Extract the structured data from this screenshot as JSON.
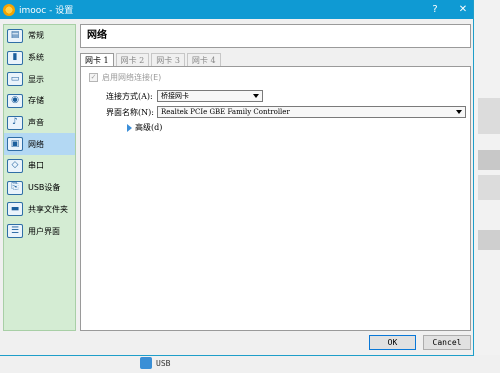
{
  "window": {
    "title": "imooc - 设置",
    "help_btn": "?",
    "close_btn": "✕"
  },
  "sidebar": {
    "items": [
      {
        "label": "常规",
        "icon": "general-icon"
      },
      {
        "label": "系统",
        "icon": "system-icon"
      },
      {
        "label": "显示",
        "icon": "display-icon"
      },
      {
        "label": "存储",
        "icon": "storage-icon"
      },
      {
        "label": "声音",
        "icon": "audio-icon"
      },
      {
        "label": "网络",
        "icon": "network-icon"
      },
      {
        "label": "串口",
        "icon": "serial-port-icon"
      },
      {
        "label": "USB设备",
        "icon": "usb-icon"
      },
      {
        "label": "共享文件夹",
        "icon": "shared-folder-icon"
      },
      {
        "label": "用户界面",
        "icon": "user-interface-icon"
      }
    ],
    "active": "网络"
  },
  "main": {
    "header": "网络",
    "tabs": [
      "网卡 1",
      "网卡 2",
      "网卡 3",
      "网卡 4"
    ],
    "enable_label": "启用网络连接(E)",
    "attach_label": "连接方式(A):",
    "attach_value": "桥接网卡",
    "name_label": "界面名称(N):",
    "name_value": "Realtek PCIe GBE Family Controller",
    "advanced_label": "高级(d)"
  },
  "footer": {
    "ok": "OK",
    "cancel": "Cancel"
  },
  "background": {
    "usb_label": "USB"
  },
  "colors": {
    "titlebar": "#0f9ad3",
    "sidebar": "#d4ecd3",
    "selected": "#b3d8f3"
  }
}
